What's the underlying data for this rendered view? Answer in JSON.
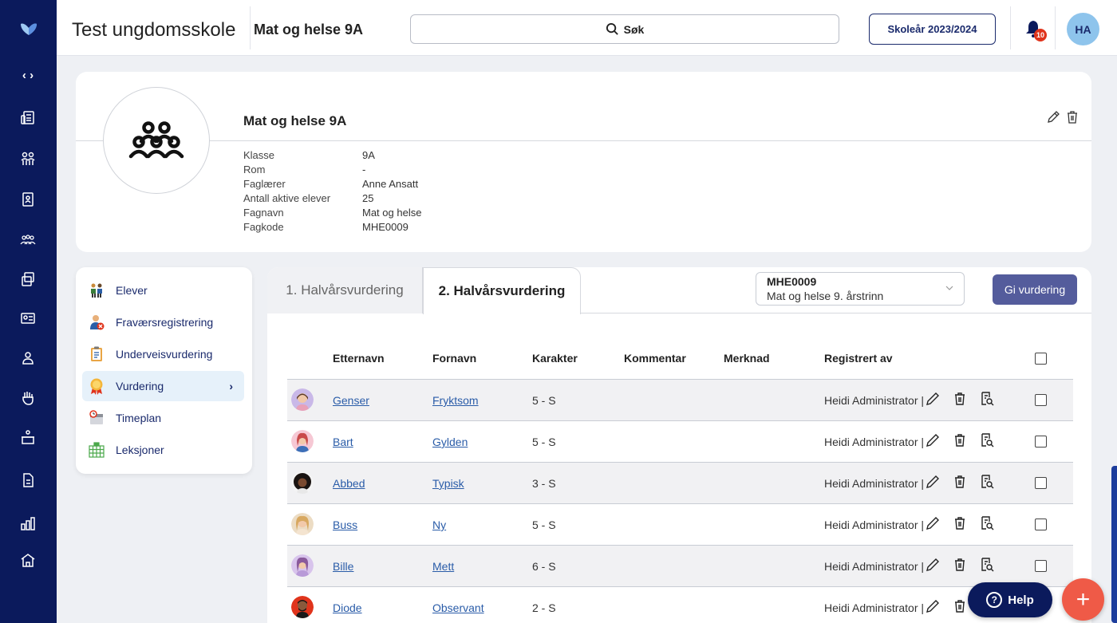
{
  "header": {
    "school_name": "Test ungdomsskole",
    "class_title": "Mat og helse 9A",
    "search_label": "Søk",
    "school_year": "Skoleår 2023/2024",
    "notification_count": "10",
    "user_initials": "HA"
  },
  "rail": {
    "icons": [
      "code-icon",
      "news-icon",
      "people-icon",
      "id-badge-icon",
      "group-icon",
      "cases-icon",
      "id-card-icon",
      "person-icon",
      "hand-icon",
      "inbox-icon",
      "document-icon",
      "bar-chart-icon",
      "school-icon"
    ]
  },
  "info": {
    "title": "Mat og helse 9A",
    "fields": [
      {
        "label": "Klasse",
        "value": "9A"
      },
      {
        "label": "Rom",
        "value": "-"
      },
      {
        "label": "Faglærer",
        "value": "Anne Ansatt"
      },
      {
        "label": "Antall aktive elever",
        "value": "25"
      },
      {
        "label": "Fagnavn",
        "value": "Mat og helse"
      },
      {
        "label": "Fagkode",
        "value": "MHE0009"
      }
    ]
  },
  "menu": {
    "items": [
      {
        "label": "Elever",
        "icon": "students-icon"
      },
      {
        "label": "Fraværsregistrering",
        "icon": "absence-icon"
      },
      {
        "label": "Underveisvurdering",
        "icon": "clipboard-icon"
      },
      {
        "label": "Vurdering",
        "icon": "medal-icon",
        "active": true
      },
      {
        "label": "Timeplan",
        "icon": "schedule-icon"
      },
      {
        "label": "Leksjoner",
        "icon": "lessons-icon"
      }
    ],
    "active_chevron": "›"
  },
  "tabs": {
    "first": "1. Halvårsvurdering",
    "second": "2. Halvårsvurdering"
  },
  "subject_select": {
    "code": "MHE0009",
    "name": "Mat og helse 9. årstrinn"
  },
  "give_button": "Gi vurdering",
  "table": {
    "columns": [
      "Etternavn",
      "Fornavn",
      "Karakter",
      "Kommentar",
      "Merknad",
      "Registrert av"
    ],
    "rows": [
      {
        "last": "Genser",
        "first": "Fryktsom",
        "grade": "5 - S",
        "registered_by": "Heidi Administrator |"
      },
      {
        "last": "Bart",
        "first": "Gylden",
        "grade": "5 - S",
        "registered_by": "Heidi Administrator |"
      },
      {
        "last": "Abbed",
        "first": "Typisk",
        "grade": "3 - S",
        "registered_by": "Heidi Administrator |"
      },
      {
        "last": "Buss",
        "first": "Ny",
        "grade": "5 - S",
        "registered_by": "Heidi Administrator |"
      },
      {
        "last": "Bille",
        "first": "Mett",
        "grade": "6 - S",
        "registered_by": "Heidi Administrator |"
      },
      {
        "last": "Diode",
        "first": "Observant",
        "grade": "2 - S",
        "registered_by": "Heidi Administrator |"
      }
    ]
  },
  "help_label": "Help",
  "fab_label": "+",
  "colors": {
    "rail": "#0b1a5c",
    "accent": "#545c9c",
    "fab": "#ef5a47",
    "link": "#2a5ca8"
  }
}
